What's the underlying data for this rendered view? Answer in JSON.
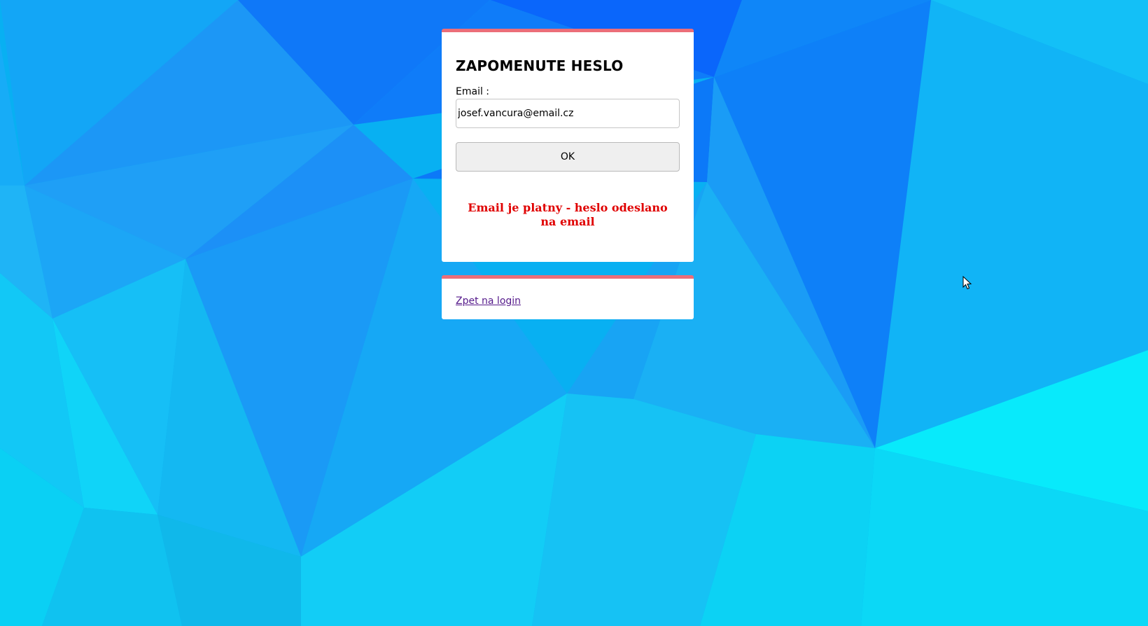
{
  "form": {
    "title": "ZAPOMENUTE HESLO",
    "email_label": "Email :",
    "email_value": "josef.vancura@email.cz",
    "ok_label": "OK",
    "status_message": "Email je platny - heslo odeslano na email",
    "status_color": "#e00000"
  },
  "links": {
    "back_to_login": "Zpet na login"
  },
  "theme": {
    "accent_color": "#ec6e79",
    "visited_link_color": "#551a8b"
  },
  "icons": {
    "cursor": "mouse-pointer-icon"
  }
}
